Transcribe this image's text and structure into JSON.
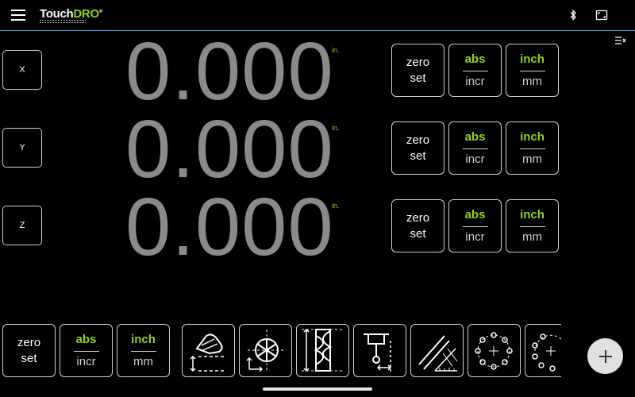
{
  "app": {
    "logo_part1": "Touch",
    "logo_part2": "DRO",
    "logo_mark": "®"
  },
  "icons": {
    "menu": "hamburger-menu-icon",
    "bluetooth": "bluetooth-icon",
    "fullscreen": "fullscreen-icon",
    "side_panel": "side-panel-icon",
    "add": "plus-icon"
  },
  "colors": {
    "accent_green": "#8fd21d",
    "accent_blue": "#3ea7e0",
    "readout_gray": "#8a8a8a"
  },
  "axes": [
    {
      "label": "X",
      "value": "0.000",
      "unit": "in.",
      "zero_top": "zero",
      "zero_bottom": "set",
      "abs": "abs",
      "incr": "incr",
      "inch": "inch",
      "mm": "mm"
    },
    {
      "label": "Y",
      "value": "0.000",
      "unit": "in.",
      "zero_top": "zero",
      "zero_bottom": "set",
      "abs": "abs",
      "incr": "incr",
      "inch": "inch",
      "mm": "mm"
    },
    {
      "label": "Z",
      "value": "0.000",
      "unit": "in.",
      "zero_top": "zero",
      "zero_bottom": "set",
      "abs": "abs",
      "incr": "incr",
      "inch": "inch",
      "mm": "mm"
    }
  ],
  "global_controls": {
    "zero_top": "zero",
    "zero_bottom": "set",
    "abs": "abs",
    "incr": "incr",
    "inch": "inch",
    "mm": "mm"
  },
  "tools": [
    "tool-offset-icon",
    "center-finder-icon",
    "end-mill-icon",
    "edge-finder-icon",
    "angled-line-icon",
    "bolt-circle-icon",
    "bolt-arc-icon"
  ]
}
